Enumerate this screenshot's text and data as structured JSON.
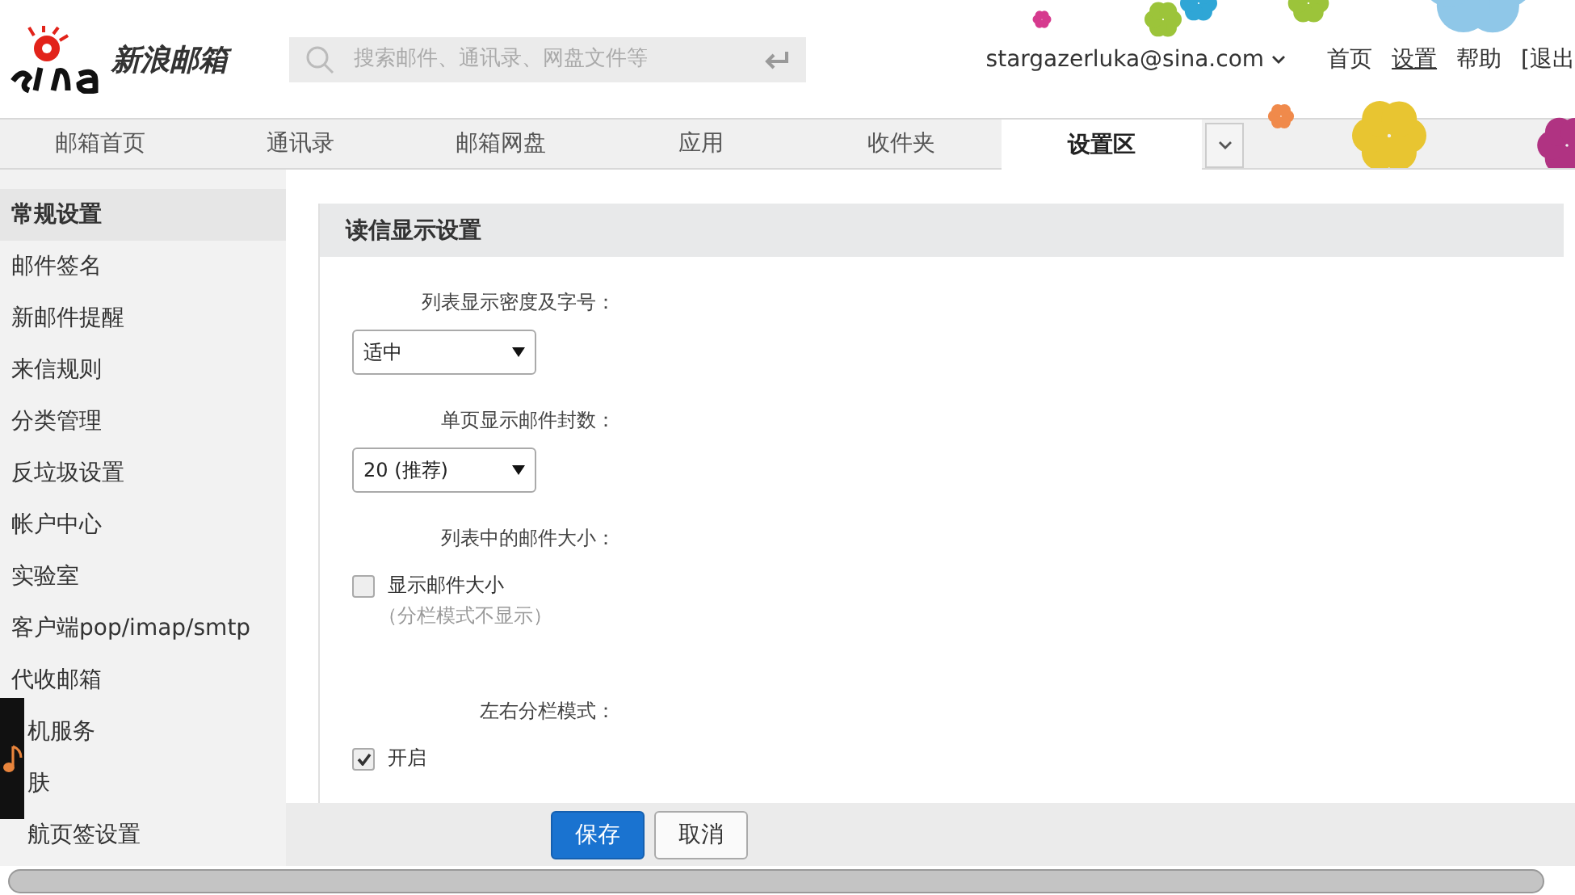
{
  "header": {
    "logo_text": "新浪邮箱",
    "search": {
      "placeholder": "搜索邮件、通讯录、网盘文件等"
    },
    "account": "stargazerluka@sina.com",
    "links": [
      {
        "label": "首页",
        "selected": false
      },
      {
        "label": "设置",
        "selected": true
      },
      {
        "label": "帮助",
        "selected": false
      },
      {
        "label": "[退出",
        "selected": false
      }
    ]
  },
  "tabs": [
    {
      "label": "邮箱首页",
      "selected": false
    },
    {
      "label": "通讯录",
      "selected": false
    },
    {
      "label": "邮箱网盘",
      "selected": false
    },
    {
      "label": "应用",
      "selected": false
    },
    {
      "label": "收件夹",
      "selected": false
    },
    {
      "label": "设置区",
      "selected": true
    }
  ],
  "sidebar": {
    "items": [
      {
        "label": "常规设置",
        "selected": true,
        "partly_hidden": false
      },
      {
        "label": "邮件签名",
        "selected": false,
        "partly_hidden": false
      },
      {
        "label": "新邮件提醒",
        "selected": false,
        "partly_hidden": false
      },
      {
        "label": "来信规则",
        "selected": false,
        "partly_hidden": false
      },
      {
        "label": "分类管理",
        "selected": false,
        "partly_hidden": false
      },
      {
        "label": "反垃圾设置",
        "selected": false,
        "partly_hidden": false
      },
      {
        "label": "帐户中心",
        "selected": false,
        "partly_hidden": false
      },
      {
        "label": "实验室",
        "selected": false,
        "partly_hidden": false
      },
      {
        "label": "客户端pop/imap/smtp",
        "selected": false,
        "partly_hidden": false
      },
      {
        "label": "代收邮箱",
        "selected": false,
        "partly_hidden": false
      },
      {
        "label": "机服务",
        "selected": false,
        "partly_hidden": true
      },
      {
        "label": "肤",
        "selected": false,
        "partly_hidden": true
      },
      {
        "label": "航页签设置",
        "selected": false,
        "partly_hidden": true
      }
    ]
  },
  "panel": {
    "title": "读信显示设置",
    "settings": [
      {
        "kind": "select",
        "label": "列表显示密度及字号：",
        "value": "适中"
      },
      {
        "kind": "select",
        "label": "单页显示邮件封数：",
        "value": "20 (推荐)"
      },
      {
        "kind": "checkbox",
        "label": "列表中的邮件大小：",
        "option": "显示邮件大小",
        "note": "（分栏模式不显示）",
        "checked": false
      },
      {
        "kind": "checkbox",
        "label": "左右分栏模式：",
        "option": "开启",
        "checked": true
      }
    ]
  },
  "buttons": [
    {
      "label": "保存",
      "kind": "primary"
    },
    {
      "label": "取消",
      "kind": "secondary"
    }
  ]
}
